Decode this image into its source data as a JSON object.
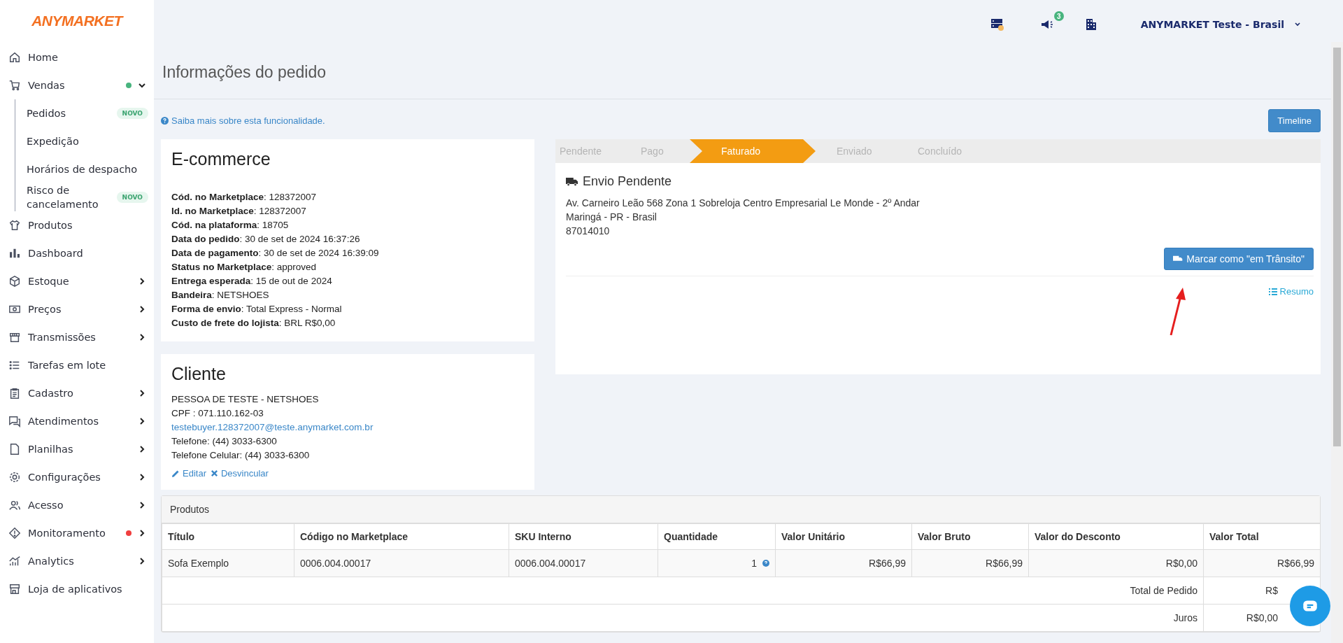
{
  "logo": "ANYMARKET",
  "sidebar": {
    "items": [
      {
        "label": "Home"
      },
      {
        "label": "Vendas",
        "expanded": true,
        "color": "#48b47e",
        "children": [
          {
            "label": "Pedidos",
            "badge": "NOVO"
          },
          {
            "label": "Expedição"
          },
          {
            "label": "Horários de despacho"
          },
          {
            "label": "Risco de cancelamento",
            "badge": "NOVO"
          }
        ]
      },
      {
        "label": "Produtos"
      },
      {
        "label": "Dashboard"
      },
      {
        "label": "Estoque",
        "expanded": false
      },
      {
        "label": "Preços",
        "expanded": false
      },
      {
        "label": "Transmissões",
        "expanded": false
      },
      {
        "label": "Tarefas em lote"
      },
      {
        "label": "Cadastro",
        "expanded": false
      },
      {
        "label": "Atendimentos",
        "expanded": false
      },
      {
        "label": "Planilhas",
        "expanded": false
      },
      {
        "label": "Configurações",
        "expanded": false
      },
      {
        "label": "Acesso",
        "expanded": false
      },
      {
        "label": "Monitoramento",
        "expanded": false,
        "color": "#f03e3e"
      },
      {
        "label": "Analytics",
        "expanded": false
      },
      {
        "label": "Loja de aplicativos"
      }
    ]
  },
  "topbar": {
    "notification_count": "3",
    "account": "ANYMARKET Teste - Brasil"
  },
  "page_title": "Informações do pedido",
  "help_link": "Saiba mais sobre esta funcionalidade.",
  "timeline_button": "Timeline",
  "ecommerce": {
    "title": "E-commerce",
    "fields": [
      "**Cód. no Marketplace**: 128372007",
      "**Id. no Marketplace**: 128372007",
      "**Cód. na plataforma**: 18705",
      "**Data do pedido**: 30 de set de 2024 16:37:26",
      "**Data de pagamento**: 30 de set de 2024 16:39:09",
      "**Status no Marketplace**: approved",
      "**Entrega esperada**: 15 de out de 2024",
      "**Bandeira**: NETSHOES",
      "**Forma de envio**: Total Express - Normal",
      "**Custo de frete do lojista**: BRL R$0,00"
    ]
  },
  "cliente": {
    "title": "Cliente",
    "name": "PESSOA DE TESTE - NETSHOES",
    "cpf": "CPF : 071.110.162-03",
    "email": "testebuyer.128372007@teste.anymarket.com.br",
    "phone": "Telefone: (44) 3033-6300",
    "mobile": "Telefone Celular: (44) 3033-6300",
    "edit": "Editar",
    "unlink": "Desvincular"
  },
  "steps": [
    {
      "label": "Pendente",
      "selected": false
    },
    {
      "label": "Pago",
      "selected": false
    },
    {
      "label": "Faturado",
      "selected": true
    },
    {
      "label": "Enviado",
      "selected": false
    },
    {
      "label": "Concluído",
      "selected": false
    }
  ],
  "shipping": {
    "title": "Envio Pendente",
    "address": [
      "Av. Carneiro Leão 568 Zona 1 Sobreloja Centro Empresarial Le Monde - 2º Andar",
      "Maringá - PR - Brasil",
      "87014010"
    ],
    "button": "Marcar como \"em Trânsito\"",
    "summary": "Resumo"
  },
  "products": {
    "title": "Produtos",
    "columns": [
      "Título",
      "Código no Marketplace",
      "SKU Interno",
      "Quantidade",
      "Valor Unitário",
      "Valor Bruto",
      "Valor do Desconto",
      "Valor Total"
    ],
    "rows": [
      [
        "Sofa Exemplo",
        "0006.004.00017",
        "0006.004.00017",
        "1",
        "R$66,99",
        "R$66,99",
        "R$0,00",
        "R$66,99"
      ]
    ],
    "totals": [
      {
        "label": "Total de Pedido",
        "value": "R$"
      },
      {
        "label": "Juros",
        "value": "R$0,00"
      }
    ]
  }
}
